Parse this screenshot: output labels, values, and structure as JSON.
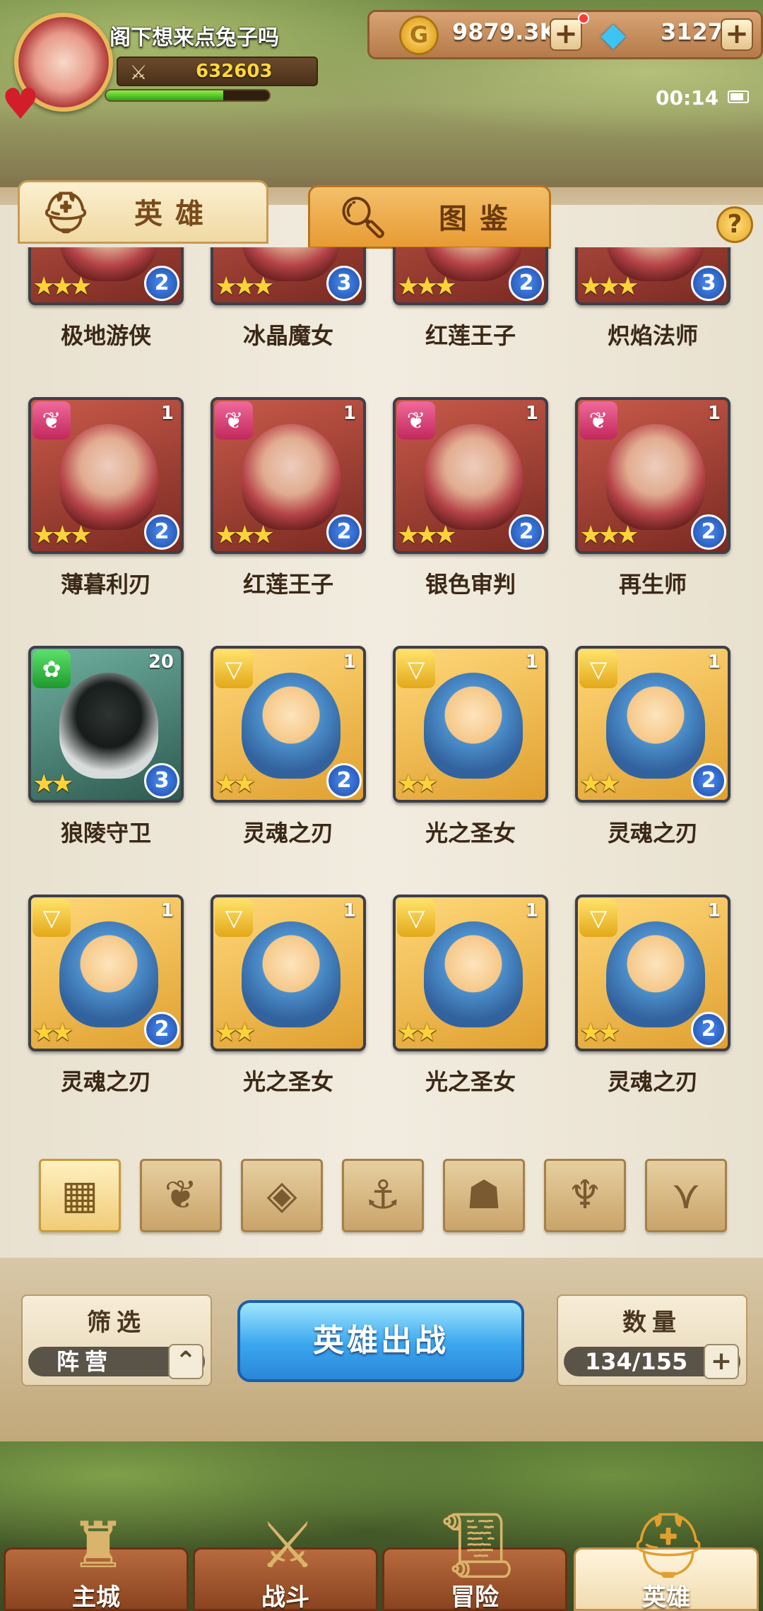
{
  "player": {
    "name": "阁下想来点兔子吗",
    "power": "632603",
    "exp_ratio": 0.72
  },
  "resources": {
    "coins": "9879.3K",
    "gems": "3127",
    "plus": "+"
  },
  "status": {
    "time": "00:14"
  },
  "tabs": {
    "heroes": "英雄",
    "codex": "图鉴"
  },
  "help": "?",
  "heroes": [
    {
      "name": "极地游侠",
      "faction": "",
      "level": "",
      "stars": "★★★",
      "rank": "2",
      "theme": "red"
    },
    {
      "name": "冰晶魔女",
      "faction": "",
      "level": "",
      "stars": "★★★",
      "rank": "3",
      "theme": "red"
    },
    {
      "name": "红莲王子",
      "faction": "",
      "level": "",
      "stars": "★★★",
      "rank": "2",
      "theme": "red"
    },
    {
      "name": "炽焰法师",
      "faction": "",
      "level": "",
      "stars": "★★★",
      "rank": "3",
      "theme": "red"
    },
    {
      "name": "薄暮利刃",
      "faction": "pink",
      "level": "1",
      "stars": "★★★",
      "rank": "2",
      "theme": "red"
    },
    {
      "name": "红莲王子",
      "faction": "pink",
      "level": "1",
      "stars": "★★★",
      "rank": "2",
      "theme": "red"
    },
    {
      "name": "银色审判",
      "faction": "pink",
      "level": "1",
      "stars": "★★★",
      "rank": "2",
      "theme": "red"
    },
    {
      "name": "再生师",
      "faction": "pink",
      "level": "1",
      "stars": "★★★",
      "rank": "2",
      "theme": "red"
    },
    {
      "name": "狼陵守卫",
      "faction": "green",
      "level": "20",
      "stars": "★★",
      "rank": "3",
      "theme": "green"
    },
    {
      "name": "灵魂之刃",
      "faction": "yellow",
      "level": "1",
      "stars": "★★",
      "rank": "2",
      "theme": "gold"
    },
    {
      "name": "光之圣女",
      "faction": "yellow",
      "level": "1",
      "stars": "★★",
      "rank": "",
      "theme": "gold"
    },
    {
      "name": "灵魂之刃",
      "faction": "yellow",
      "level": "1",
      "stars": "★★",
      "rank": "2",
      "theme": "gold"
    },
    {
      "name": "灵魂之刃",
      "faction": "yellow",
      "level": "1",
      "stars": "★★",
      "rank": "2",
      "theme": "gold"
    },
    {
      "name": "光之圣女",
      "faction": "yellow",
      "level": "1",
      "stars": "★★",
      "rank": "",
      "theme": "gold"
    },
    {
      "name": "光之圣女",
      "faction": "yellow",
      "level": "1",
      "stars": "★★",
      "rank": "",
      "theme": "gold"
    },
    {
      "name": "灵魂之刃",
      "faction": "yellow",
      "level": "1",
      "stars": "★★",
      "rank": "2",
      "theme": "gold"
    }
  ],
  "filters": [
    "grid-icon",
    "flame-icon",
    "diamond-icon",
    "anchor-icon",
    "beast-icon",
    "horned-icon",
    "v-icon"
  ],
  "filter_box": {
    "title": "筛选",
    "value": "阵营"
  },
  "deploy_label": "英雄出战",
  "count_box": {
    "title": "数量",
    "value": "134/155"
  },
  "nav": [
    {
      "label": "主城",
      "icon": "castle-icon"
    },
    {
      "label": "战斗",
      "icon": "swords-icon"
    },
    {
      "label": "冒险",
      "icon": "scroll-icon"
    },
    {
      "label": "英雄",
      "icon": "helmet-icon",
      "active": true
    }
  ]
}
